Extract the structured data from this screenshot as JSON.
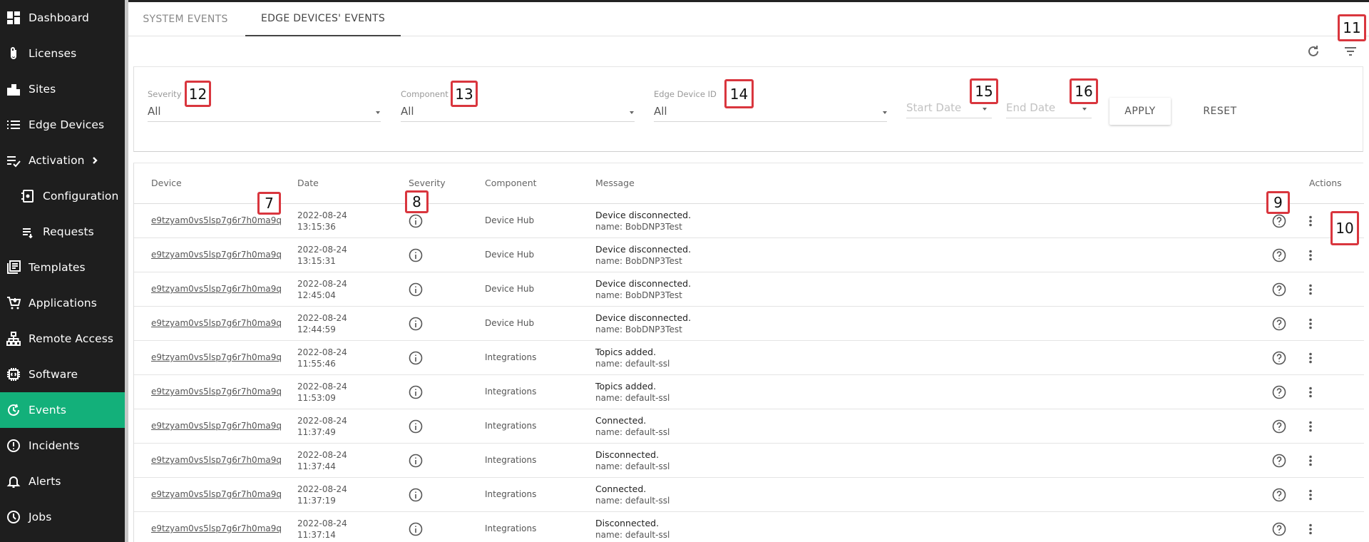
{
  "sidebar": {
    "items": [
      {
        "label": "Dashboard",
        "icon": "dashboard-icon"
      },
      {
        "label": "Licenses",
        "icon": "paperclip-icon"
      },
      {
        "label": "Sites",
        "icon": "building-icon"
      },
      {
        "label": "Edge Devices",
        "icon": "list-icon"
      },
      {
        "label": "Activation",
        "icon": "checklist-icon"
      },
      {
        "label": "Configuration",
        "icon": "config-file-icon"
      },
      {
        "label": "Requests",
        "icon": "requests-list-icon"
      },
      {
        "label": "Templates",
        "icon": "templates-icon"
      },
      {
        "label": "Applications",
        "icon": "cart-icon"
      },
      {
        "label": "Remote Access",
        "icon": "network-icon"
      },
      {
        "label": "Software",
        "icon": "chip-icon"
      },
      {
        "label": "Events",
        "icon": "events-icon"
      },
      {
        "label": "Incidents",
        "icon": "alert-circle-icon"
      },
      {
        "label": "Alerts",
        "icon": "bell-icon"
      },
      {
        "label": "Jobs",
        "icon": "clock-icon"
      }
    ],
    "active": "Events",
    "active_color": "#13b07a",
    "background": "#1e1e1e"
  },
  "tabs": [
    {
      "label": "SYSTEM EVENTS"
    },
    {
      "label": "EDGE DEVICES' EVENTS"
    }
  ],
  "active_tab": "EDGE DEVICES' EVENTS",
  "filters": {
    "severity": {
      "label": "Severity",
      "value": "All"
    },
    "component": {
      "label": "Component",
      "value": "All"
    },
    "edge_device_id": {
      "label": "Edge Device ID",
      "value": "All"
    },
    "start_date": {
      "placeholder": "Start Date"
    },
    "end_date": {
      "placeholder": "End Date"
    },
    "apply_label": "APPLY",
    "reset_label": "RESET"
  },
  "table": {
    "headers": {
      "device": "Device",
      "date": "Date",
      "severity": "Severity",
      "component": "Component",
      "message": "Message",
      "actions": "Actions"
    },
    "rows": [
      {
        "device": "e9tzyam0vs5lsp7g6r7h0ma9q",
        "date": "2022-08-24",
        "time": "13:15:36",
        "component": "Device Hub",
        "message": "Device disconnected.",
        "detail": "name: BobDNP3Test"
      },
      {
        "device": "e9tzyam0vs5lsp7g6r7h0ma9q",
        "date": "2022-08-24",
        "time": "13:15:31",
        "component": "Device Hub",
        "message": "Device disconnected.",
        "detail": "name: BobDNP3Test"
      },
      {
        "device": "e9tzyam0vs5lsp7g6r7h0ma9q",
        "date": "2022-08-24",
        "time": "12:45:04",
        "component": "Device Hub",
        "message": "Device disconnected.",
        "detail": "name: BobDNP3Test"
      },
      {
        "device": "e9tzyam0vs5lsp7g6r7h0ma9q",
        "date": "2022-08-24",
        "time": "12:44:59",
        "component": "Device Hub",
        "message": "Device disconnected.",
        "detail": "name: BobDNP3Test"
      },
      {
        "device": "e9tzyam0vs5lsp7g6r7h0ma9q",
        "date": "2022-08-24",
        "time": "11:55:46",
        "component": "Integrations",
        "message": "Topics added.",
        "detail": "name: default-ssl"
      },
      {
        "device": "e9tzyam0vs5lsp7g6r7h0ma9q",
        "date": "2022-08-24",
        "time": "11:53:09",
        "component": "Integrations",
        "message": "Topics added.",
        "detail": "name: default-ssl"
      },
      {
        "device": "e9tzyam0vs5lsp7g6r7h0ma9q",
        "date": "2022-08-24",
        "time": "11:37:49",
        "component": "Integrations",
        "message": "Connected.",
        "detail": "name: default-ssl"
      },
      {
        "device": "e9tzyam0vs5lsp7g6r7h0ma9q",
        "date": "2022-08-24",
        "time": "11:37:44",
        "component": "Integrations",
        "message": "Disconnected.",
        "detail": "name: default-ssl"
      },
      {
        "device": "e9tzyam0vs5lsp7g6r7h0ma9q",
        "date": "2022-08-24",
        "time": "11:37:19",
        "component": "Integrations",
        "message": "Connected.",
        "detail": "name: default-ssl"
      },
      {
        "device": "e9tzyam0vs5lsp7g6r7h0ma9q",
        "date": "2022-08-24",
        "time": "11:37:14",
        "component": "Integrations",
        "message": "Disconnected.",
        "detail": "name: default-ssl"
      }
    ],
    "severity_icon": "info-icon",
    "row_action_icons": [
      "help-icon",
      "more-vert-icon"
    ]
  },
  "toolbar": {
    "icons": [
      "refresh-icon",
      "filter-list-icon"
    ]
  },
  "callouts": {
    "c7": "7",
    "c8": "8",
    "c9": "9",
    "c10": "10",
    "c11": "11",
    "c12": "12",
    "c13": "13",
    "c14": "14",
    "c15": "15",
    "c16": "16"
  },
  "callout_color": "#d9363e"
}
